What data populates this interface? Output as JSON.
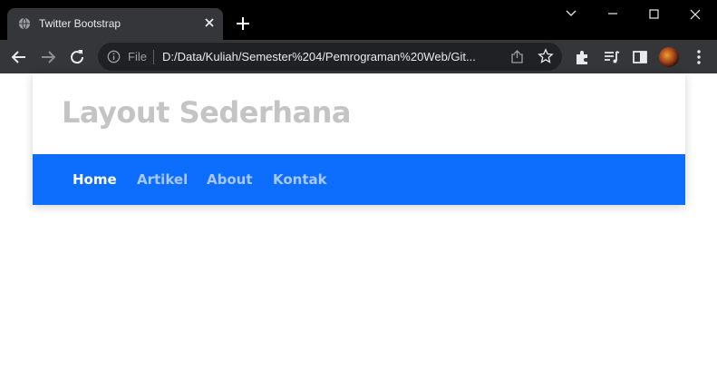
{
  "browser": {
    "tab_title": "Twitter Bootstrap",
    "url_scheme": "File",
    "url": "D:/Data/Kuliah/Semester%204/Pemrograman%20Web/Git..."
  },
  "page": {
    "title": "Layout Sederhana",
    "nav": [
      {
        "label": "Home",
        "active": true
      },
      {
        "label": "Artikel",
        "active": false
      },
      {
        "label": "About",
        "active": false
      },
      {
        "label": "Kontak",
        "active": false
      }
    ]
  },
  "colors": {
    "navbar": "#0d6efd",
    "title": "#c4c4c4",
    "nav_inactive": "#a7c8ff",
    "nav_active": "#ffffff"
  }
}
